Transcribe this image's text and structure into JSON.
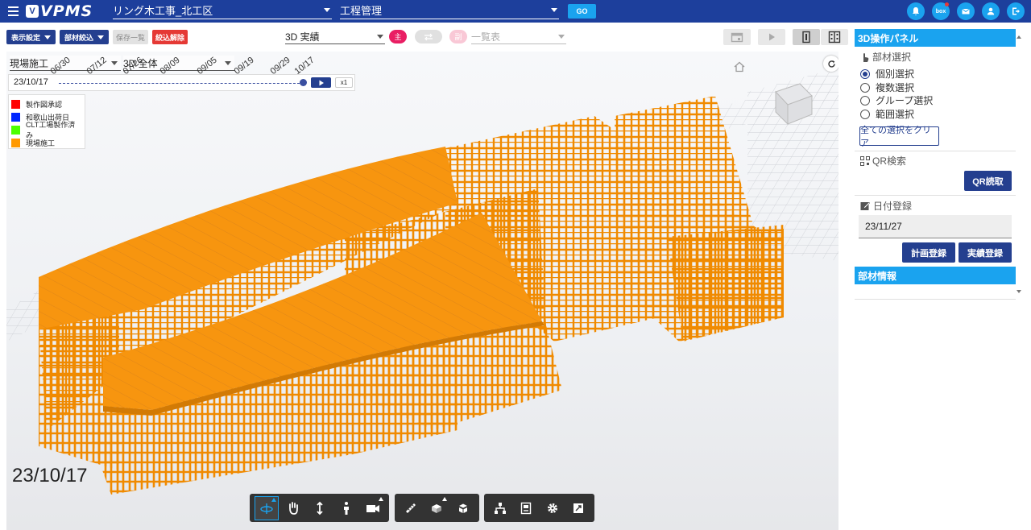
{
  "app": {
    "logo_text": "VPMS",
    "project": "リング木工事_北工区",
    "module": "工程管理",
    "go_label": "GO",
    "header_icons": [
      "bell-icon",
      "box-icon",
      "mail-icon",
      "user-icon",
      "logout-icon"
    ],
    "box_label": "box"
  },
  "toolbar": {
    "display_settings": "表示設定",
    "member_filter": "部材絞込",
    "save_list": "保存一覧",
    "clear_filter": "絞込解除",
    "view_mode": "3D 実績",
    "main_chip": "主",
    "sub_chip": "副",
    "list_placeholder": "一覧表"
  },
  "viewport": {
    "filter_stage": "現場施工",
    "filter_scope": "3D 全体",
    "timeline_date": "23/10/17",
    "timeline_ticks": [
      "06/30",
      "07/12",
      "07/26",
      "08/09",
      "09/05",
      "09/19",
      "09/29",
      "10/17"
    ],
    "timeline_progress": 1.0,
    "speed": "x1",
    "big_date": "23/10/17",
    "legend": [
      {
        "label": "製作図承認",
        "color": "#ff0000"
      },
      {
        "label": "和歌山出荷日",
        "color": "#0026ff"
      },
      {
        "label": "CLT工場製作済み",
        "color": "#4cff00"
      },
      {
        "label": "現場施工",
        "color": "#ff9900"
      }
    ]
  },
  "tools": {
    "group1": [
      "orbit-icon",
      "pan-icon",
      "zoom-icon",
      "walk-icon",
      "camera-icon"
    ],
    "group2": [
      "measure-icon",
      "section-icon",
      "explode-icon"
    ],
    "group3": [
      "model-tree-icon",
      "properties-icon",
      "settings-icon",
      "fullscreen-icon"
    ]
  },
  "panel": {
    "title": "3D操作パネル",
    "member_select_title": "部材選択",
    "options": [
      "個別選択",
      "複数選択",
      "グループ選択",
      "範囲選択"
    ],
    "selected_option": "個別選択",
    "clear_all": "全ての選択をクリア",
    "qr_title": "QR検索",
    "qr_button": "QR読取",
    "date_title": "日付登録",
    "date_value": "23/11/27",
    "plan_button": "計画登録",
    "actual_button": "実績登録",
    "member_info_title": "部材情報"
  },
  "colors": {
    "header": "#1d3f9c",
    "accent": "#1aa3ef",
    "navy": "#243f8f",
    "timber": "#ff9900"
  }
}
